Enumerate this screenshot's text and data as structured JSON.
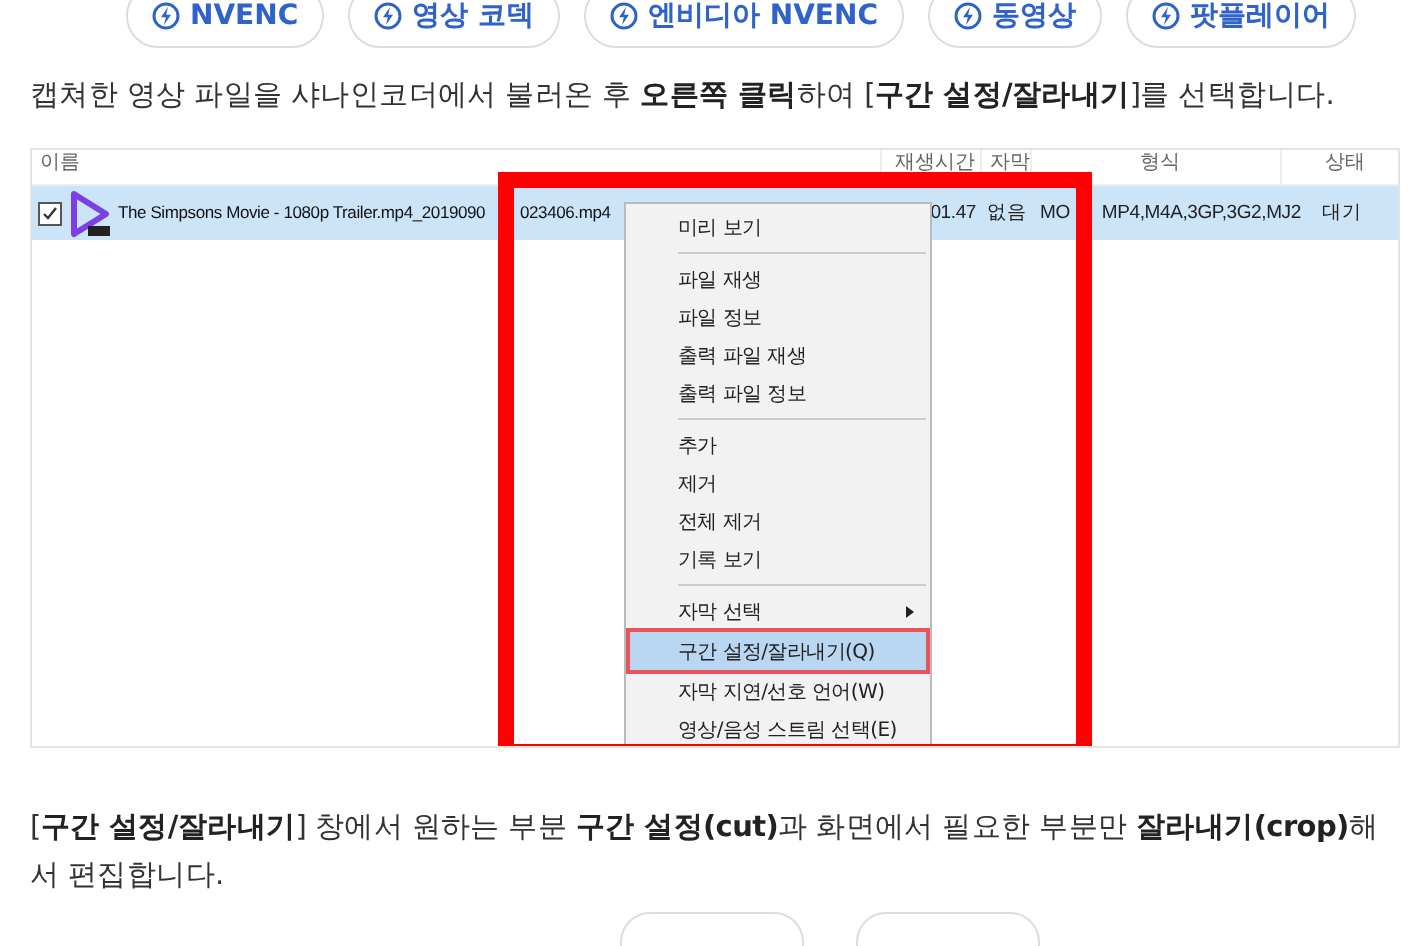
{
  "tags": [
    {
      "label": "NVENC"
    },
    {
      "label": "영상 코덱"
    },
    {
      "label": "엔비디아 NVENC"
    },
    {
      "label": "동영상"
    },
    {
      "label": "팟플레이어"
    }
  ],
  "intro": "캡쳐한 영상 파일을 샤나인코더에서 불러온 후 **오른쪽 클릭**하여 [**구간 설정/잘라내기**]를 선택합니다.",
  "file_list": {
    "columns": [
      "이름",
      "재생시간",
      "자막",
      "형식",
      "상태"
    ],
    "rows": [
      {
        "checked": true,
        "selected": true,
        "name": "The Simpsons Movie - 1080p Trailer.mp4_2019090",
        "name_tail": "023406.mp4",
        "duration": "01.47",
        "subtitle": "없음",
        "format_head": "MO",
        "format": "MP4,M4A,3GP,3G2,MJ2",
        "status": "대기"
      }
    ]
  },
  "context_menu": {
    "groups": [
      [
        {
          "label": "미리 보기",
          "submenu": false,
          "selected": false
        }
      ],
      [
        {
          "label": "파일 재생",
          "submenu": false,
          "selected": false
        },
        {
          "label": "파일 정보",
          "submenu": false,
          "selected": false
        },
        {
          "label": "출력 파일 재생",
          "submenu": false,
          "selected": false
        },
        {
          "label": "출력 파일 정보",
          "submenu": false,
          "selected": false
        }
      ],
      [
        {
          "label": "추가",
          "submenu": false,
          "selected": false
        },
        {
          "label": "제거",
          "submenu": false,
          "selected": false
        },
        {
          "label": "전체 제거",
          "submenu": false,
          "selected": false
        },
        {
          "label": "기록 보기",
          "submenu": false,
          "selected": false
        }
      ],
      [
        {
          "label": "자막 선택",
          "submenu": true,
          "selected": false
        },
        {
          "label": "구간 설정/잘라내기(Q)",
          "submenu": false,
          "selected": true
        },
        {
          "label": "자막 지연/선호 언어(W)",
          "submenu": false,
          "selected": false
        },
        {
          "label": "영상/음성 스트림 선택(E)",
          "submenu": false,
          "selected": false
        }
      ]
    ]
  },
  "description": "[**구간 설정/잘라내기**] 창에서 원하는 부분 **구간 설정(cut)**과 화면에서 필요한 부분만 **잘라내기(crop)**해서 편집합니다."
}
